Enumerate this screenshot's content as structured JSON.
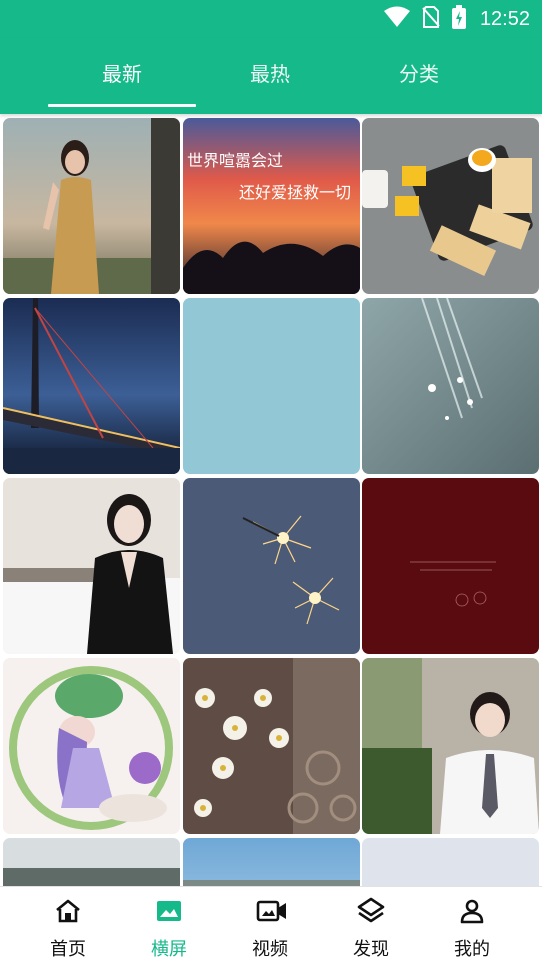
{
  "status_bar": {
    "time": "12:52",
    "icons": [
      "wifi-icon",
      "no-sim-icon",
      "battery-charging-icon"
    ]
  },
  "tabs": [
    {
      "label": "最新",
      "active": true
    },
    {
      "label": "最热",
      "active": false
    },
    {
      "label": "分类",
      "active": false
    }
  ],
  "grid": {
    "tiles": [
      {
        "content": "woman-in-gold-dress-photo"
      },
      {
        "content": "sunset-sky-handwritten-text",
        "text_line1": "世界喧嚣会过",
        "text_line2": "还好爱拯救一切"
      },
      {
        "content": "breakfast-toast-milk-photo"
      },
      {
        "content": "bridge-night-city-photo"
      },
      {
        "content": "solid-light-blue-tile"
      },
      {
        "content": "sparkling-water-photo"
      },
      {
        "content": "woman-in-black-blazer-photo"
      },
      {
        "content": "sparklers-photo"
      },
      {
        "content": "dark-red-minimal-text-art"
      },
      {
        "content": "anime-girl-flowers-illustration"
      },
      {
        "content": "daisies-photo"
      },
      {
        "content": "young-man-white-shirt-photo"
      },
      {
        "content": "landscape-clouds-photo"
      },
      {
        "content": "blue-sky-beach-photo"
      },
      {
        "content": "pale-gray-tile"
      }
    ]
  },
  "bottom_nav": {
    "items": [
      {
        "label": "首页",
        "icon": "home-icon",
        "active": false
      },
      {
        "label": "横屏",
        "icon": "landscape-image-icon",
        "active": true
      },
      {
        "label": "视频",
        "icon": "video-camera-icon",
        "active": false
      },
      {
        "label": "发现",
        "icon": "layers-icon",
        "active": false
      },
      {
        "label": "我的",
        "icon": "user-icon",
        "active": false
      }
    ]
  },
  "colors": {
    "brand": "#16b98a",
    "nav_active": "#16b98a",
    "nav_inactive": "#111111"
  }
}
